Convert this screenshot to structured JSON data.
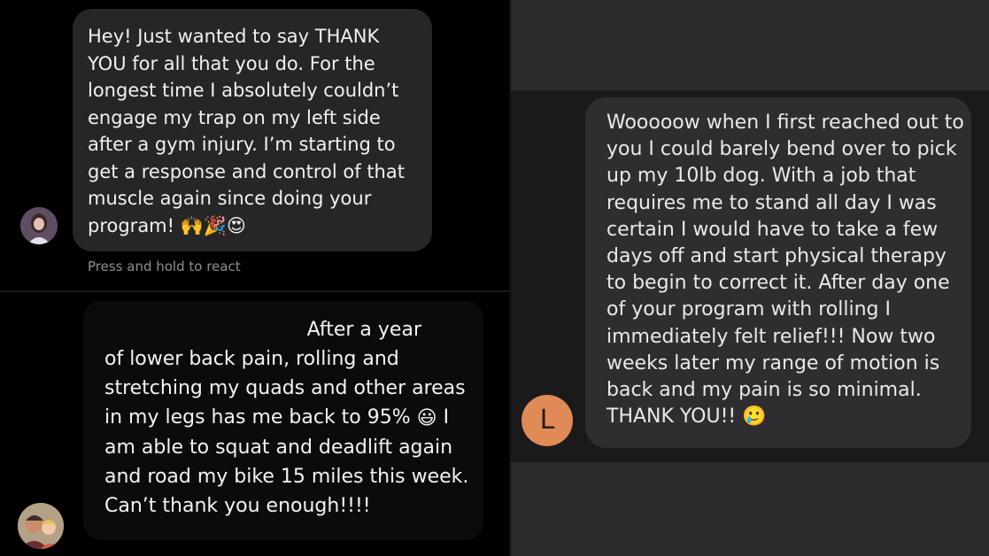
{
  "panel_a": {
    "message": "Hey! Just wanted to say THANK YOU for all that you do. For the longest time I absolutely couldn’t engage my trap on my left side after a gym injury. I’m starting to get a response and control of that muscle again since doing your program!",
    "emojis": "🙌🎉😍",
    "hint": "Press and hold to react"
  },
  "panel_b": {
    "message_first": "After a year",
    "message_part1": "of lower back pain, rolling and stretching my quads and other areas in my legs has me back to 95%",
    "emoji": "😃",
    "message_part2": "I am able to squat and deadlift again and road my bike 15 miles this week. Can’t thank you enough!!!!"
  },
  "panel_c": {
    "message": "Wooooow when I first reached out to you I could barely bend over to pick up my 10lb dog. With a job that requires me to stand all day I was certain I would have to take a few days off and start physical therapy to begin to correct it. After day one of your program with rolling I immediately felt relief!!! Now two weeks later my range of motion is back and my pain is so minimal. THANK YOU!!",
    "emoji": "🥲",
    "avatar_letter": "L",
    "colors": {
      "avatar": "#e08b57",
      "bubble": "#2e2e30",
      "background": "#2b2b2c"
    }
  }
}
